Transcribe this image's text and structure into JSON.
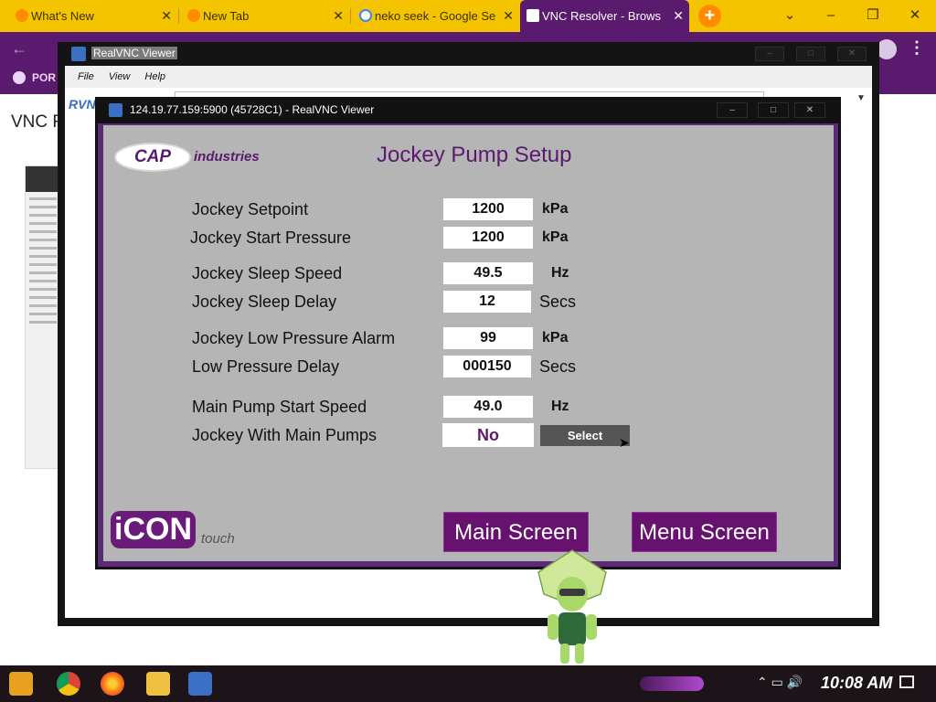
{
  "browser": {
    "tabs": [
      {
        "title": "What's New",
        "active": false
      },
      {
        "title": "New Tab",
        "active": false
      },
      {
        "title": "neko seek - Google Se",
        "active": false
      },
      {
        "title": "VNC Resolver - Brows",
        "active": true
      }
    ],
    "new_tab_icon": "plus-icon",
    "bookmark": "POR",
    "page_heading": "VNC Re"
  },
  "outer_vnc": {
    "title": "RealVNC Viewer",
    "menu": [
      "File",
      "View",
      "Help"
    ],
    "logo": "RVNC"
  },
  "inner_vnc": {
    "title": "124.19.77.159:5900 (45728C1) - RealVNC Viewer"
  },
  "hmi": {
    "logo_cap": "CAP",
    "logo_industries": "industries",
    "title": "Jockey Pump Setup",
    "params": [
      {
        "label": "Jockey Setpoint",
        "value": "1200",
        "unit": "kPa"
      },
      {
        "label": "Jockey Start Pressure",
        "value": "1200",
        "unit": "kPa"
      },
      {
        "label": "Jockey Sleep Speed",
        "value": "49.5",
        "unit": "Hz"
      },
      {
        "label": "Jockey Sleep Delay",
        "value": "12",
        "unit": "Secs"
      },
      {
        "label": "Jockey Low Pressure Alarm",
        "value": "99",
        "unit": "kPa"
      },
      {
        "label": "Low Pressure Delay",
        "value": "000150",
        "unit": "Secs"
      },
      {
        "label": "Main Pump Start Speed",
        "value": "49.0",
        "unit": "Hz"
      },
      {
        "label": "Jockey With Main Pumps",
        "value": "No",
        "unit": ""
      }
    ],
    "select_label": "Select",
    "icon_logo": "iCON",
    "icon_touch": "touch",
    "main_screen": "Main Screen",
    "menu_screen": "Menu Screen"
  },
  "taskbar": {
    "clock": "10:08 AM"
  },
  "colors": {
    "accent_purple": "#5a1a6e",
    "tab_yellow": "#f5c400",
    "hmi_gray": "#b5b5b5"
  }
}
